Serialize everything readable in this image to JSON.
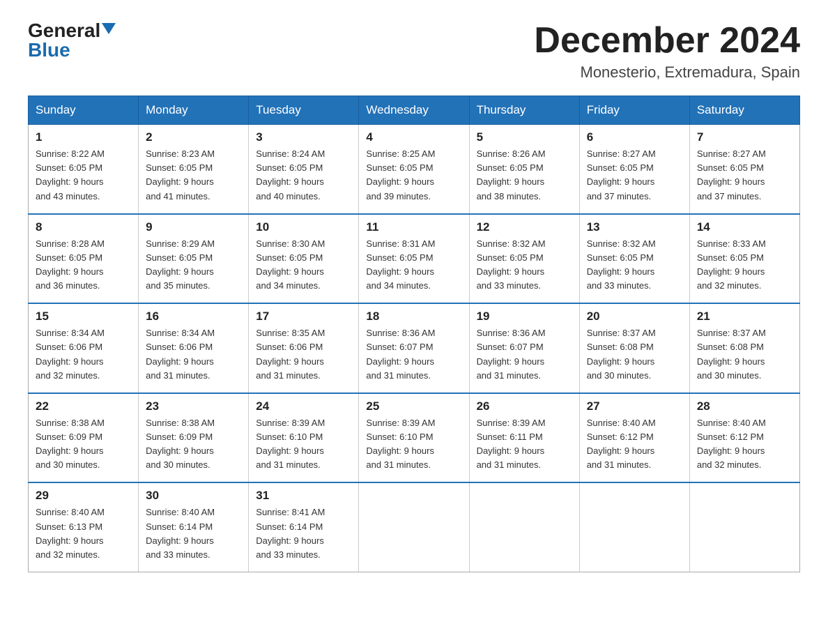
{
  "header": {
    "logo_general": "General",
    "logo_blue": "Blue",
    "month_title": "December 2024",
    "location": "Monesterio, Extremadura, Spain"
  },
  "weekdays": [
    "Sunday",
    "Monday",
    "Tuesday",
    "Wednesday",
    "Thursday",
    "Friday",
    "Saturday"
  ],
  "weeks": [
    [
      {
        "day": "1",
        "sunrise": "8:22 AM",
        "sunset": "6:05 PM",
        "daylight": "9 hours and 43 minutes."
      },
      {
        "day": "2",
        "sunrise": "8:23 AM",
        "sunset": "6:05 PM",
        "daylight": "9 hours and 41 minutes."
      },
      {
        "day": "3",
        "sunrise": "8:24 AM",
        "sunset": "6:05 PM",
        "daylight": "9 hours and 40 minutes."
      },
      {
        "day": "4",
        "sunrise": "8:25 AM",
        "sunset": "6:05 PM",
        "daylight": "9 hours and 39 minutes."
      },
      {
        "day": "5",
        "sunrise": "8:26 AM",
        "sunset": "6:05 PM",
        "daylight": "9 hours and 38 minutes."
      },
      {
        "day": "6",
        "sunrise": "8:27 AM",
        "sunset": "6:05 PM",
        "daylight": "9 hours and 37 minutes."
      },
      {
        "day": "7",
        "sunrise": "8:27 AM",
        "sunset": "6:05 PM",
        "daylight": "9 hours and 37 minutes."
      }
    ],
    [
      {
        "day": "8",
        "sunrise": "8:28 AM",
        "sunset": "6:05 PM",
        "daylight": "9 hours and 36 minutes."
      },
      {
        "day": "9",
        "sunrise": "8:29 AM",
        "sunset": "6:05 PM",
        "daylight": "9 hours and 35 minutes."
      },
      {
        "day": "10",
        "sunrise": "8:30 AM",
        "sunset": "6:05 PM",
        "daylight": "9 hours and 34 minutes."
      },
      {
        "day": "11",
        "sunrise": "8:31 AM",
        "sunset": "6:05 PM",
        "daylight": "9 hours and 34 minutes."
      },
      {
        "day": "12",
        "sunrise": "8:32 AM",
        "sunset": "6:05 PM",
        "daylight": "9 hours and 33 minutes."
      },
      {
        "day": "13",
        "sunrise": "8:32 AM",
        "sunset": "6:05 PM",
        "daylight": "9 hours and 33 minutes."
      },
      {
        "day": "14",
        "sunrise": "8:33 AM",
        "sunset": "6:05 PM",
        "daylight": "9 hours and 32 minutes."
      }
    ],
    [
      {
        "day": "15",
        "sunrise": "8:34 AM",
        "sunset": "6:06 PM",
        "daylight": "9 hours and 32 minutes."
      },
      {
        "day": "16",
        "sunrise": "8:34 AM",
        "sunset": "6:06 PM",
        "daylight": "9 hours and 31 minutes."
      },
      {
        "day": "17",
        "sunrise": "8:35 AM",
        "sunset": "6:06 PM",
        "daylight": "9 hours and 31 minutes."
      },
      {
        "day": "18",
        "sunrise": "8:36 AM",
        "sunset": "6:07 PM",
        "daylight": "9 hours and 31 minutes."
      },
      {
        "day": "19",
        "sunrise": "8:36 AM",
        "sunset": "6:07 PM",
        "daylight": "9 hours and 31 minutes."
      },
      {
        "day": "20",
        "sunrise": "8:37 AM",
        "sunset": "6:08 PM",
        "daylight": "9 hours and 30 minutes."
      },
      {
        "day": "21",
        "sunrise": "8:37 AM",
        "sunset": "6:08 PM",
        "daylight": "9 hours and 30 minutes."
      }
    ],
    [
      {
        "day": "22",
        "sunrise": "8:38 AM",
        "sunset": "6:09 PM",
        "daylight": "9 hours and 30 minutes."
      },
      {
        "day": "23",
        "sunrise": "8:38 AM",
        "sunset": "6:09 PM",
        "daylight": "9 hours and 30 minutes."
      },
      {
        "day": "24",
        "sunrise": "8:39 AM",
        "sunset": "6:10 PM",
        "daylight": "9 hours and 31 minutes."
      },
      {
        "day": "25",
        "sunrise": "8:39 AM",
        "sunset": "6:10 PM",
        "daylight": "9 hours and 31 minutes."
      },
      {
        "day": "26",
        "sunrise": "8:39 AM",
        "sunset": "6:11 PM",
        "daylight": "9 hours and 31 minutes."
      },
      {
        "day": "27",
        "sunrise": "8:40 AM",
        "sunset": "6:12 PM",
        "daylight": "9 hours and 31 minutes."
      },
      {
        "day": "28",
        "sunrise": "8:40 AM",
        "sunset": "6:12 PM",
        "daylight": "9 hours and 32 minutes."
      }
    ],
    [
      {
        "day": "29",
        "sunrise": "8:40 AM",
        "sunset": "6:13 PM",
        "daylight": "9 hours and 32 minutes."
      },
      {
        "day": "30",
        "sunrise": "8:40 AM",
        "sunset": "6:14 PM",
        "daylight": "9 hours and 33 minutes."
      },
      {
        "day": "31",
        "sunrise": "8:41 AM",
        "sunset": "6:14 PM",
        "daylight": "9 hours and 33 minutes."
      },
      null,
      null,
      null,
      null
    ]
  ],
  "labels": {
    "sunrise": "Sunrise:",
    "sunset": "Sunset:",
    "daylight": "Daylight:"
  }
}
